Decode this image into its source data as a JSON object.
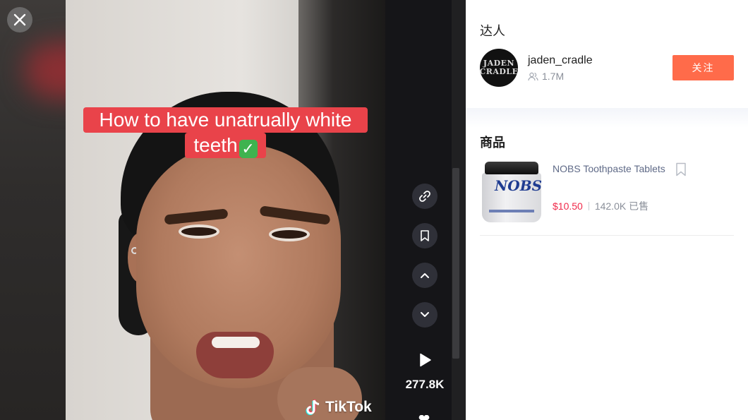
{
  "video": {
    "caption_line1": "How to have unatrually white",
    "caption_line2": "teeth",
    "watermark": "TikTok",
    "views": "277.8K"
  },
  "viewer_controls": {
    "close": "close-icon",
    "rail_icons": [
      "link-icon",
      "bookmark-icon",
      "chevron-up-icon",
      "chevron-down-icon"
    ],
    "play": "play-icon"
  },
  "creator": {
    "section_title": "达人",
    "avatar_text": "JADEN CRADLE",
    "username": "jaden_cradle",
    "followers": "1.7M",
    "follow_label": "关注"
  },
  "products": {
    "section_title": "商品",
    "items": [
      {
        "name": "NOBS Toothpaste Tablets",
        "image_label": "NOBS",
        "price": "$10.50",
        "sold": "142.0K 已售"
      }
    ]
  },
  "colors": {
    "accent": "#ff6b4a",
    "price": "#f0294a",
    "caption_bg": "#e9434a"
  }
}
